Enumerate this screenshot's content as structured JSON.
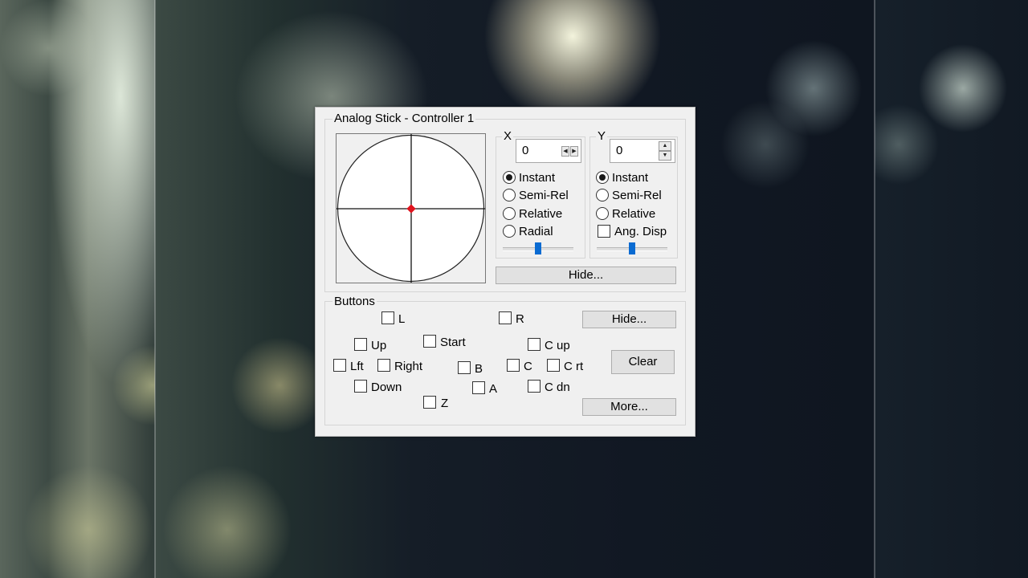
{
  "dialog": {
    "title": "Analog Stick - Controller 1",
    "stick": {
      "x": 0,
      "y": 0,
      "center_marker_color": "#e0141e"
    },
    "x_axis": {
      "label": "X",
      "value": "0",
      "modes": [
        {
          "label": "Instant",
          "checked": true
        },
        {
          "label": "Semi-Rel",
          "checked": false
        },
        {
          "label": "Relative",
          "checked": false
        },
        {
          "label": "Radial",
          "checked": false
        }
      ],
      "slider_fraction": 0.5
    },
    "y_axis": {
      "label": "Y",
      "value": "0",
      "modes": [
        {
          "label": "Instant",
          "checked": true
        },
        {
          "label": "Semi-Rel",
          "checked": false
        },
        {
          "label": "Relative",
          "checked": false
        }
      ],
      "ang_disp": {
        "label": "Ang. Disp",
        "checked": false
      },
      "slider_fraction": 0.5
    },
    "hide_stick_button": "Hide...",
    "buttons_group": {
      "label": "Buttons",
      "checkboxes": {
        "l": "L",
        "r": "R",
        "start": "Start",
        "up": "Up",
        "lft": "Lft",
        "right": "Right",
        "down": "Down",
        "z": "Z",
        "b": "B",
        "a": "A",
        "c_up": "C up",
        "c": "C",
        "c_rt": "C rt",
        "c_dn": "C dn"
      },
      "hide_button": "Hide...",
      "clear_button": "Clear",
      "more_button": "More..."
    }
  }
}
